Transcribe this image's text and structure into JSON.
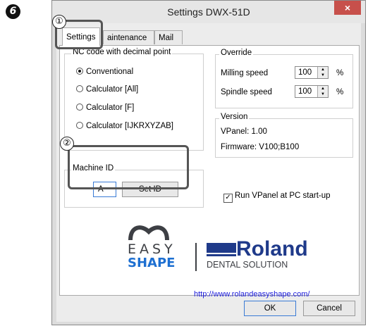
{
  "step_number": "6",
  "window": {
    "title": "Settings DWX-51D",
    "close_glyph": "×"
  },
  "tabs": [
    {
      "label": "Settings",
      "active": true
    },
    {
      "label": "Maintenance",
      "shown_text": "aintenance"
    },
    {
      "label": "Mail"
    }
  ],
  "callouts": {
    "one": "①",
    "two": "②"
  },
  "nc_code": {
    "label": "NC code with decimal point",
    "options": [
      {
        "label": "Conventional",
        "selected": true
      },
      {
        "label": "Calculator [All]",
        "selected": false
      },
      {
        "label": "Calculator [F]",
        "selected": false
      },
      {
        "label": "Calculator [IJKRXYZAB]",
        "selected": false
      }
    ]
  },
  "override": {
    "label": "Override",
    "milling": {
      "label": "Milling speed",
      "value": "100",
      "unit": "%"
    },
    "spindle": {
      "label": "Spindle speed",
      "value": "100",
      "unit": "%"
    }
  },
  "version": {
    "label": "Version",
    "vpanel": "VPanel: 1.00",
    "firmware": "Firmware: V100;B100"
  },
  "machine_id": {
    "label": "Machine ID",
    "value": "A",
    "set_button": "Set ID"
  },
  "run_at_startup": {
    "label": "Run VPanel at PC start-up",
    "checked": true
  },
  "logo": {
    "easy": "EASY",
    "shape": "SHAPE",
    "roland": "Roland",
    "dental": "DENTAL SOLUTION"
  },
  "link": "http://www.rolandeasyshape.com/",
  "buttons": {
    "ok": "OK",
    "cancel": "Cancel"
  },
  "colors": {
    "link": "#1a1adb",
    "logo_blue": "#1d6fd1",
    "logo_dark": "#3d3f44",
    "roland_blue": "#1f3a8a"
  }
}
